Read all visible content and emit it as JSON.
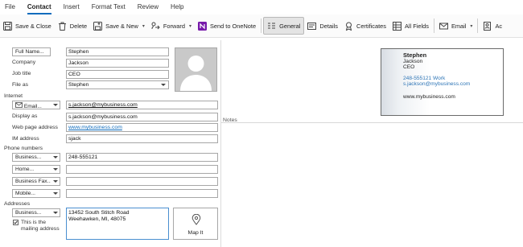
{
  "menu": [
    "File",
    "Contact",
    "Insert",
    "Format Text",
    "Review",
    "Help"
  ],
  "ribbon": {
    "save_close": "Save & Close",
    "delete": "Delete",
    "save_new": "Save & New",
    "forward": "Forward",
    "onenote": "Send to OneNote",
    "general": "General",
    "details": "Details",
    "certificates": "Certificates",
    "all_fields": "All Fields",
    "email": "Email",
    "more": "Ac"
  },
  "form": {
    "full_name_label": "Full Name...",
    "full_name": "Stephen",
    "company_label": "Company",
    "company": "Jackson",
    "job_title_label": "Job title",
    "job_title": "CEO",
    "file_as_label": "File as",
    "file_as": "Stephen",
    "internet_label": "Internet",
    "email_button": "Email...",
    "email": "s.jackson@mybusiness.com",
    "display_as_label": "Display as",
    "display_as": "s.jackson@mybusiness.com",
    "web_label": "Web page address",
    "web": "www.mybusiness.com",
    "im_label": "IM address",
    "im": "sjack",
    "phone_label": "Phone numbers",
    "phone_business_btn": "Business...",
    "phone_business": "248-555121",
    "phone_home_btn": "Home...",
    "phone_fax_btn": "Business Fax...",
    "phone_mobile_btn": "Mobile...",
    "addresses_label": "Addresses",
    "address_btn": "Business...",
    "address_line1": "13452 South Stitch Road",
    "address_line2": "Weehawken, MI, 48075",
    "mailing_line1": "This is the",
    "mailing_line2": "mailing address",
    "map_it": "Map It"
  },
  "card": {
    "name": "Stephen",
    "company": "Jackson",
    "title": "CEO",
    "phone": "248-555121 Work",
    "email": "s.jackson@mybusiness.com",
    "web": "www.mybusiness.com"
  },
  "notes_label": "Notes",
  "colors": {
    "accent": "#0f6cbd",
    "link": "#0f6cbd",
    "card_blue": "#2e75b6"
  }
}
